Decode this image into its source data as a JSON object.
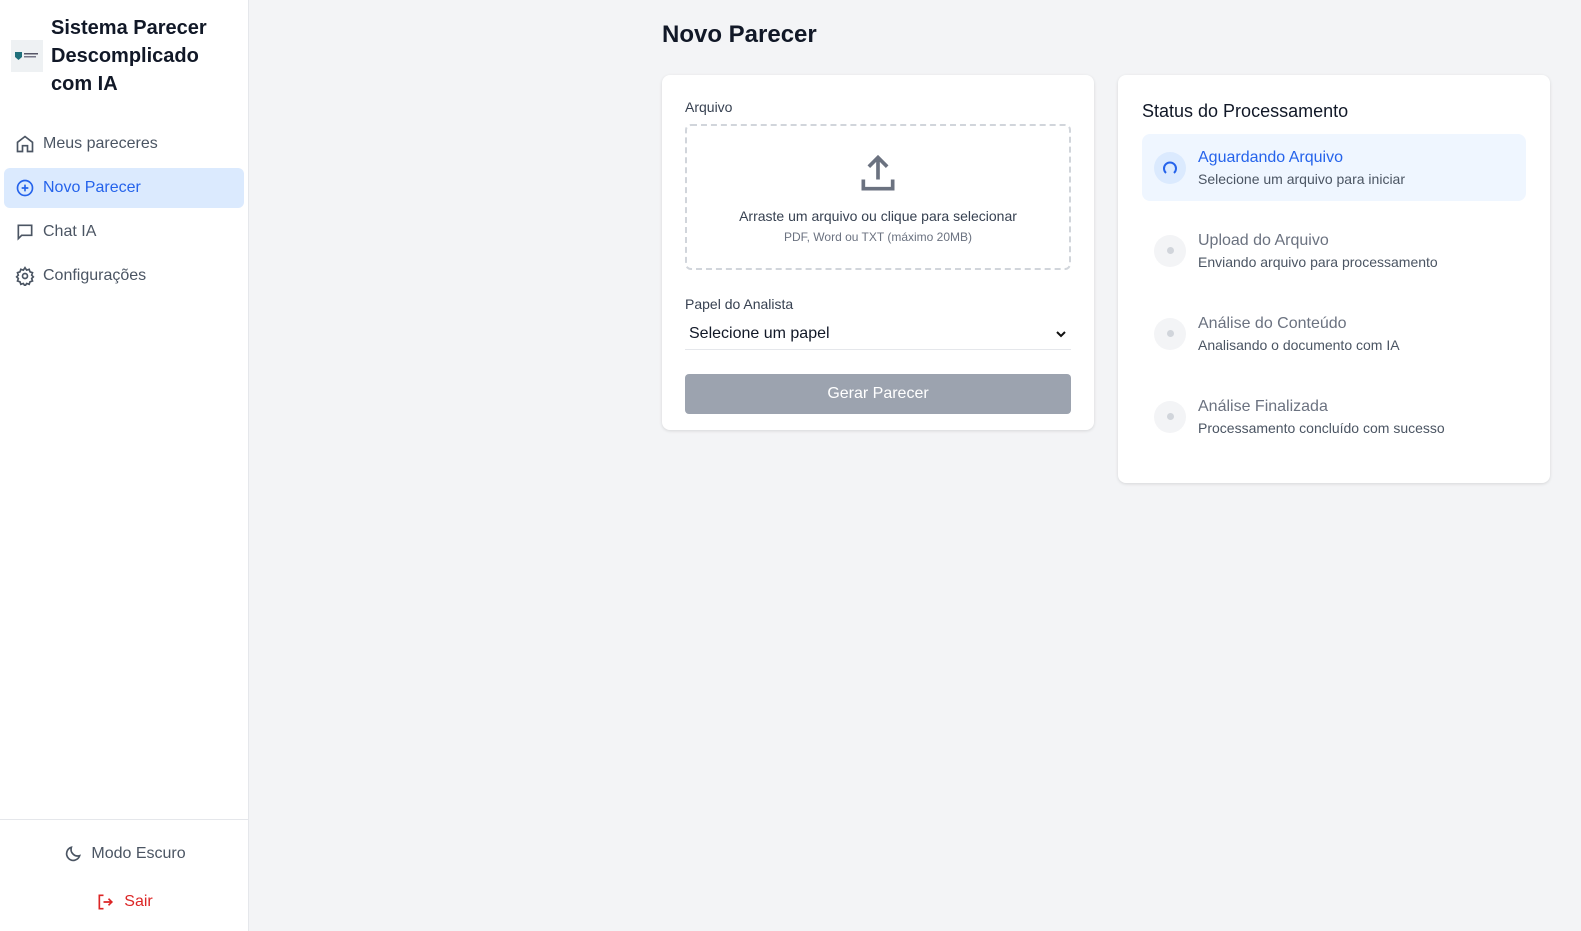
{
  "sidebar": {
    "title": "Sistema Parecer Descomplicado com IA",
    "items": [
      {
        "label": "Meus pareceres"
      },
      {
        "label": "Novo Parecer"
      },
      {
        "label": "Chat IA"
      },
      {
        "label": "Configurações"
      }
    ],
    "dark_mode": "Modo Escuro",
    "logout": "Sair"
  },
  "main": {
    "title": "Novo Parecer",
    "form": {
      "file_label": "Arquivo",
      "drop_text": "Arraste um arquivo ou clique para selecionar",
      "drop_hint": "PDF, Word ou TXT (máximo 20MB)",
      "role_label": "Papel do Analista",
      "role_value": "Selecione um papel",
      "submit": "Gerar Parecer"
    },
    "status": {
      "title": "Status do Processamento",
      "steps": [
        {
          "title": "Aguardando Arquivo",
          "desc": "Selecione um arquivo para iniciar",
          "state": "active"
        },
        {
          "title": "Upload do Arquivo",
          "desc": "Enviando arquivo para processamento",
          "state": "pending"
        },
        {
          "title": "Análise do Conteúdo",
          "desc": "Analisando o documento com IA",
          "state": "pending"
        },
        {
          "title": "Análise Finalizada",
          "desc": "Processamento concluído com sucesso",
          "state": "pending"
        }
      ]
    }
  },
  "colors": {
    "accent": "#2563eb",
    "danger": "#dc2626"
  }
}
